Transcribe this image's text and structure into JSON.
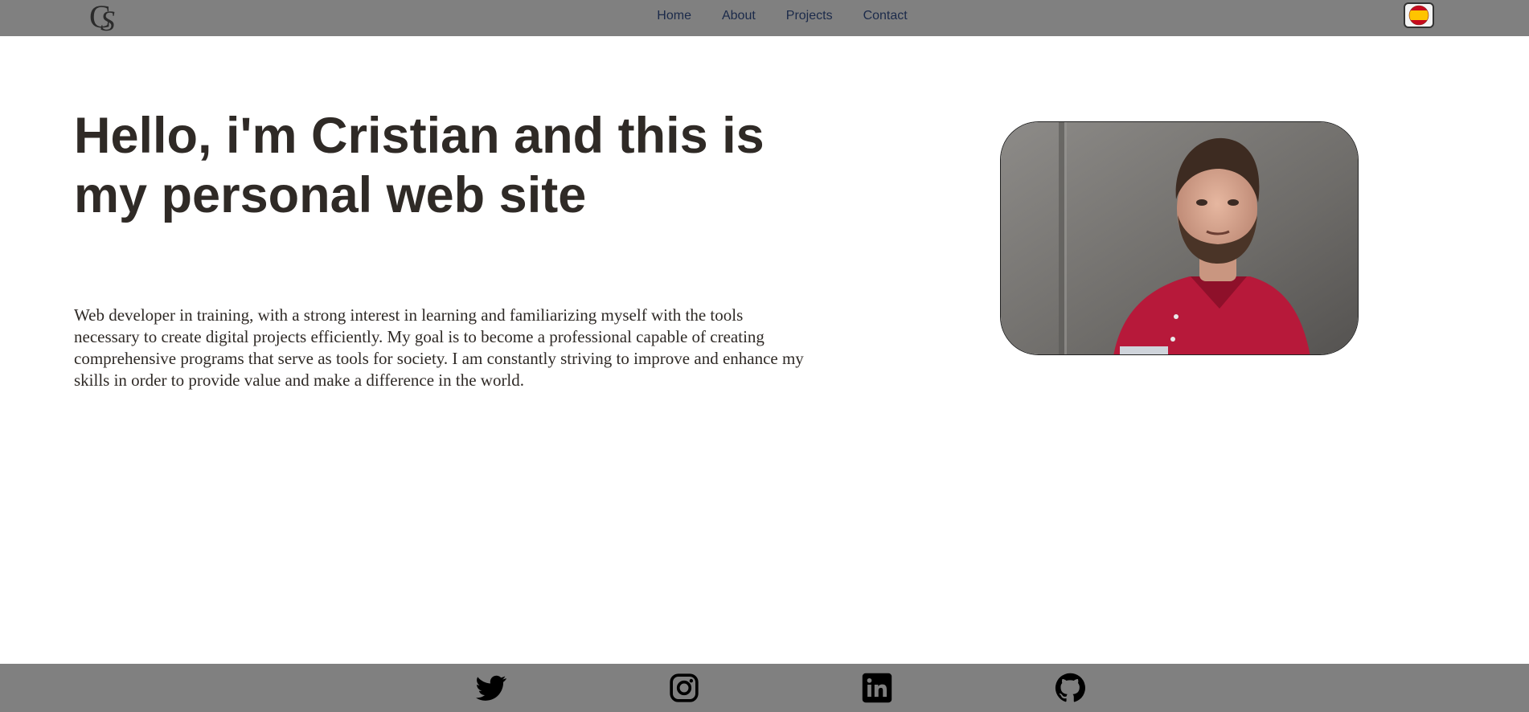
{
  "header": {
    "logo_text": "CS",
    "nav": [
      "Home",
      "About",
      "Projects",
      "Contact"
    ],
    "language_icon": "spain-flag-icon"
  },
  "hero": {
    "title": "Hello, i'm Cristian and this is my personal web site",
    "bio": "Web developer in training, with a strong interest in learning and familiarizing myself with the tools necessary to create digital projects efficiently. My goal is to become a professional capable of creating comprehensive programs that serve as tools for society. I am constantly striving to improve and enhance my skills in order to provide value and make a difference in the world."
  },
  "footer": {
    "social_icons": [
      "twitter-icon",
      "instagram-icon",
      "linkedin-icon",
      "github-icon"
    ]
  },
  "colors": {
    "bar_background": "#808080",
    "nav_link": "#1b2a4a",
    "text": "#2f2a26",
    "page_background": "#ffffff"
  }
}
